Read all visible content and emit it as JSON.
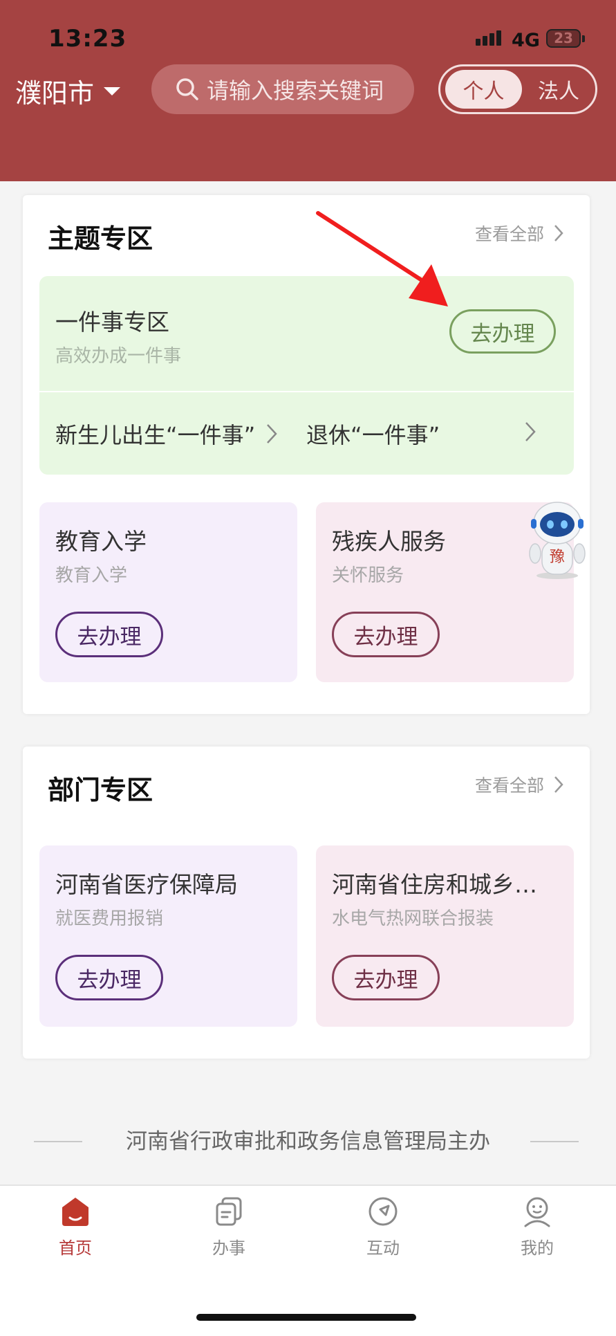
{
  "status": {
    "time": "13:23",
    "network": "4G",
    "battery": "23"
  },
  "header": {
    "city": "濮阳市",
    "search_placeholder": "请输入搜索关键词",
    "toggle": {
      "active": "个人",
      "inactive": "法人"
    },
    "color": "#a54342"
  },
  "theme_section": {
    "title": "主题专区",
    "view_all": "查看全部",
    "featured": {
      "title": "一件事专区",
      "subtitle": "高效办成一件事",
      "button": "去办理",
      "links": [
        "新生儿出生“一件事”",
        "退休“一件事”"
      ]
    },
    "tiles": [
      {
        "title": "教育入学",
        "subtitle": "教育入学",
        "button": "去办理"
      },
      {
        "title": "残疾人服务",
        "subtitle": "关怀服务",
        "button": "去办理"
      }
    ]
  },
  "dept_section": {
    "title": "部门专区",
    "view_all": "查看全部",
    "tiles": [
      {
        "title": "河南省医疗保障局",
        "subtitle": "就医费用报销",
        "button": "去办理"
      },
      {
        "title": "河南省住房和城乡…",
        "subtitle": "水电气热网联合报装",
        "button": "去办理"
      }
    ]
  },
  "footer": {
    "text": "河南省行政审批和政务信息管理局主办"
  },
  "tabbar": {
    "items": [
      {
        "label": "首页",
        "icon": "home-icon",
        "active": true
      },
      {
        "label": "办事",
        "icon": "documents-icon",
        "active": false
      },
      {
        "label": "互动",
        "icon": "compass-icon",
        "active": false
      },
      {
        "label": "我的",
        "icon": "profile-icon",
        "active": false
      }
    ],
    "active_color": "#b63a3a"
  },
  "robot_badge": "豫"
}
